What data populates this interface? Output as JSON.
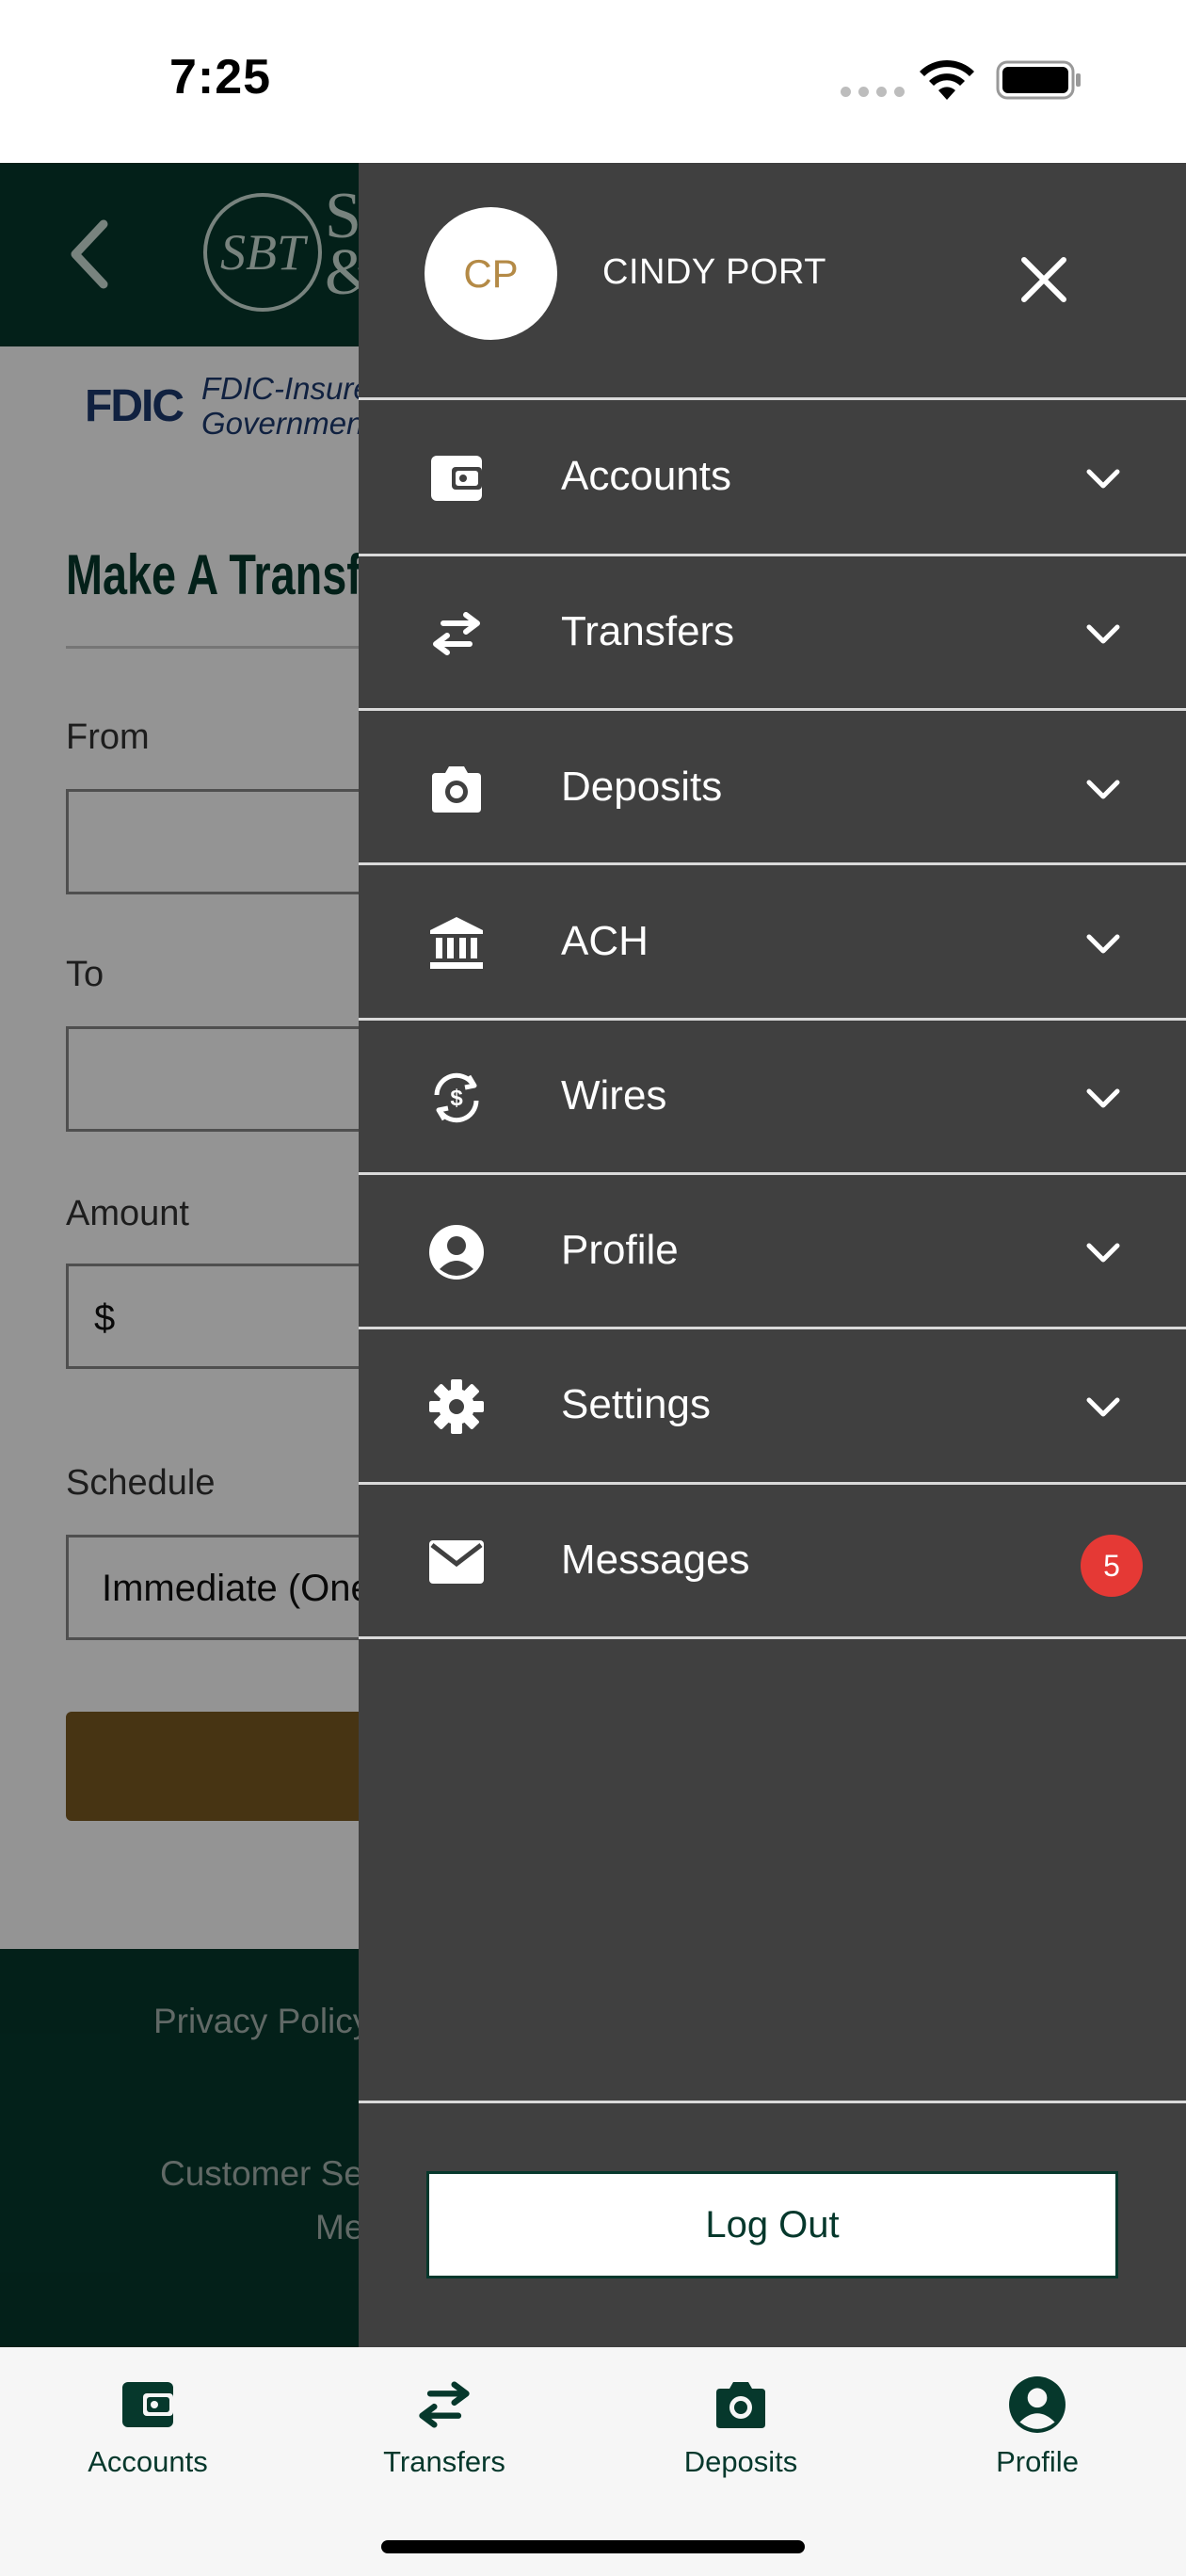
{
  "status_bar": {
    "time": "7:25"
  },
  "background_page": {
    "logo_monogram": "SBT",
    "logo_text": "S\n&",
    "fdic_logo": "FDIC",
    "fdic_text_line1": "FDIC-Insure",
    "fdic_text_line2": "Governmen",
    "title": "Make A Transfe",
    "from_label": "From",
    "to_label": "To",
    "amount_label": "Amount",
    "amount_prefix": "$",
    "schedule_label": "Schedule",
    "schedule_value": "Immediate (One",
    "footer_privacy": "Privacy Policy",
    "footer_customer_service": "Customer Ser",
    "footer_member": "Me"
  },
  "drawer": {
    "avatar_initials": "CP",
    "user_name": "CINDY PORT",
    "items": [
      {
        "label": "Accounts",
        "icon": "wallet-icon"
      },
      {
        "label": "Transfers",
        "icon": "transfer-arrows-icon"
      },
      {
        "label": "Deposits",
        "icon": "camera-icon"
      },
      {
        "label": "ACH",
        "icon": "bank-icon"
      },
      {
        "label": "Wires",
        "icon": "money-transfer-icon"
      },
      {
        "label": "Profile",
        "icon": "user-circle-icon"
      },
      {
        "label": "Settings",
        "icon": "gear-icon"
      },
      {
        "label": "Messages",
        "icon": "envelope-icon",
        "badge": "5"
      }
    ],
    "logout_label": "Log Out"
  },
  "tab_bar": {
    "tabs": [
      {
        "label": "Accounts",
        "icon": "wallet-icon"
      },
      {
        "label": "Transfers",
        "icon": "transfer-arrows-icon"
      },
      {
        "label": "Deposits",
        "icon": "camera-icon"
      },
      {
        "label": "Profile",
        "icon": "user-circle-icon"
      }
    ]
  },
  "colors": {
    "brand_green": "#06382c",
    "drawer_bg": "#404040",
    "accent_gold": "#b48a46",
    "badge_red": "#e53935"
  }
}
